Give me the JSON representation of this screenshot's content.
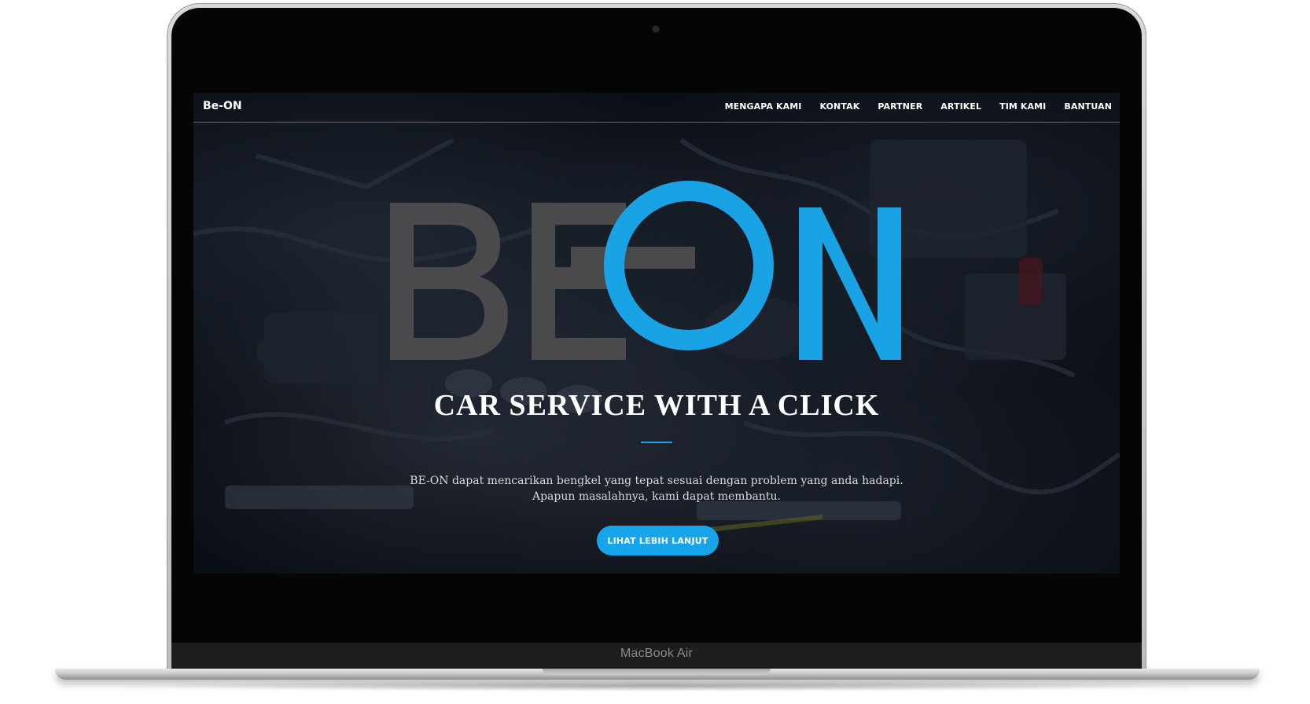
{
  "device": {
    "model_label": "MacBook Air"
  },
  "navbar": {
    "brand": "Be-ON",
    "links": [
      "MENGAPA KAMI",
      "KONTAK",
      "PARTNER",
      "ARTIKEL",
      "TIM KAMI",
      "BANTUAN"
    ]
  },
  "hero": {
    "logo": {
      "text": "BEON",
      "gray_color": "#4a4a4c",
      "blue_color": "#19a3e4"
    },
    "headline": "CAR SERVICE WITH A CLICK",
    "divider_color": "#19a3e4",
    "lead_line_1": "BE-ON dapat mencarikan bengkel yang tepat sesuai dengan problem yang anda hadapi.",
    "lead_line_2": "Apapun masalahnya, kami dapat membantu.",
    "cta_label": "LIHAT LEBIH LANJUT",
    "cta_color": "#17a5ea"
  }
}
